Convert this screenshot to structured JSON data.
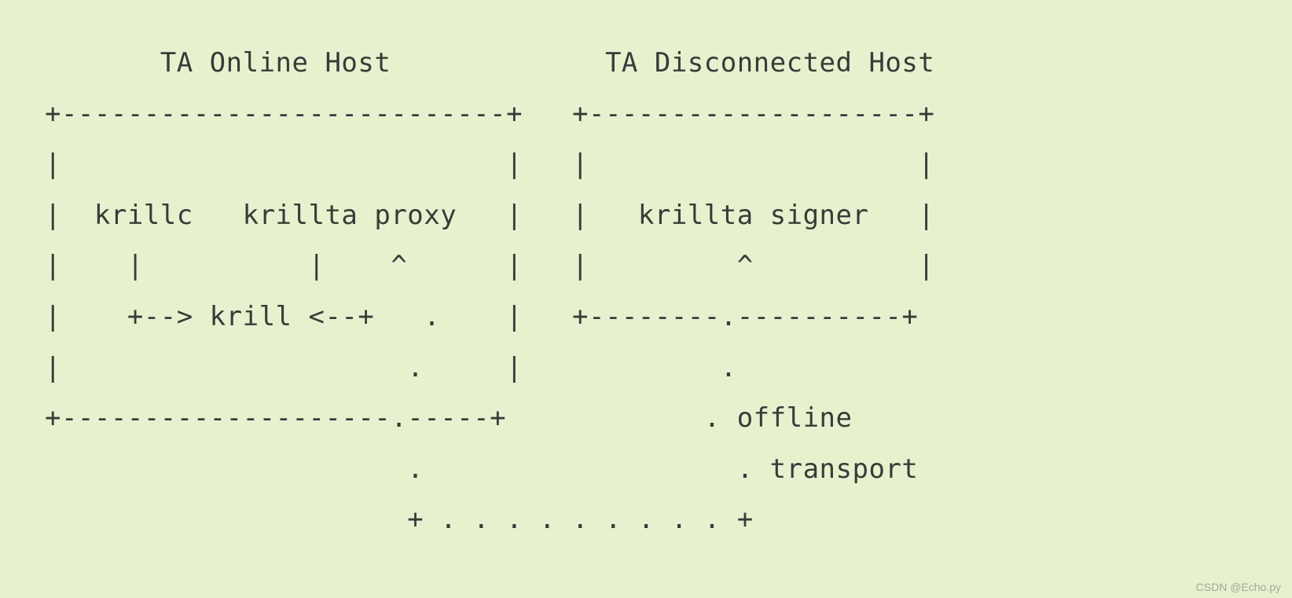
{
  "title_left": "TA Online Host",
  "title_right": "TA Disconnected Host",
  "node_krillc": "krillc",
  "node_krillta_proxy": "krillta proxy",
  "node_krillta_signer": "krillta signer",
  "node_krill": "krill",
  "label_offline": "offline",
  "label_transport": "transport",
  "watermark": "CSDN @Echo.py",
  "ascii_lines": [
    "        TA Online Host             TA Disconnected Host",
    " +---------------------------+   +--------------------+",
    " |                           |   |                    |",
    " |  krillc   krillta proxy   |   |   krillta signer   |",
    " |    |          |    ^      |   |         ^          |",
    " |    +--> krill <--+   .    |   +--------.----------+",
    " |                     .     |            .",
    " +--------------------.-----+            . offline",
    "                       .                   . transport",
    "                       + . . . . . . . . . +"
  ]
}
